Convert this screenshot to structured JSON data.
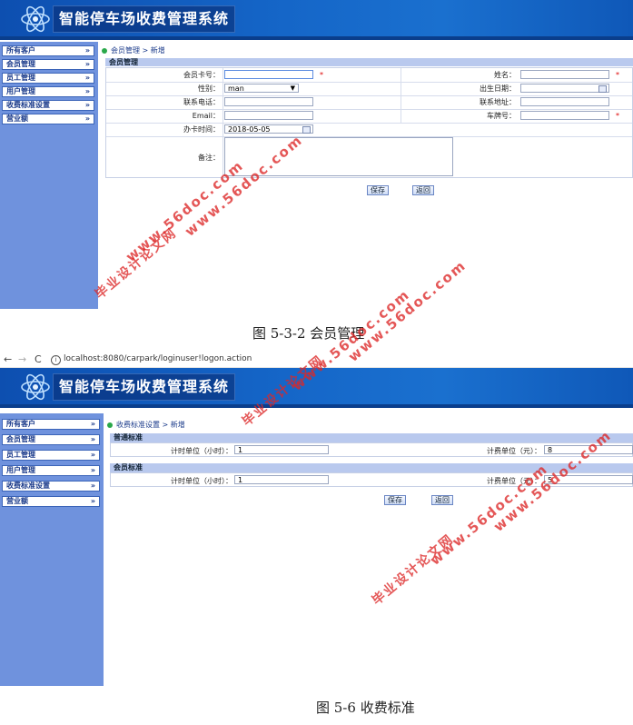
{
  "app_title": "智能停车场收费管理系统",
  "menu": [
    {
      "label": "所有客户"
    },
    {
      "label": "会员管理"
    },
    {
      "label": "员工管理"
    },
    {
      "label": "用户管理"
    },
    {
      "label": "收费标准设置"
    },
    {
      "label": "营业额"
    }
  ],
  "menu_chevron": "»",
  "shot1": {
    "breadcrumb": {
      "section": "会员管理",
      "sep": ">",
      "page": "新增"
    },
    "section_title": "会员管理",
    "fields": {
      "card_no": {
        "label": "会员卡号：",
        "value": ""
      },
      "name": {
        "label": "姓名：",
        "value": ""
      },
      "gender": {
        "label": "性别：",
        "value": "man"
      },
      "birthday": {
        "label": "出生日期：",
        "value": ""
      },
      "phone": {
        "label": "联系电话：",
        "value": ""
      },
      "address": {
        "label": "联系地址：",
        "value": ""
      },
      "email": {
        "label": "Email：",
        "value": ""
      },
      "plate": {
        "label": "车牌号：",
        "value": ""
      },
      "card_date": {
        "label": "办卡时间：",
        "value": "2018-05-05"
      },
      "remark": {
        "label": "备注：",
        "value": ""
      }
    },
    "required_mark": "*",
    "save_label": "保存",
    "back_label": "返回",
    "caption": "图 5-3-2 会员管理"
  },
  "browser": {
    "url": "localhost:8080/carpark/loginuser!logon.action",
    "back": "←",
    "forward": "→",
    "reload": "C",
    "info": "i"
  },
  "shot2": {
    "breadcrumb": {
      "section": "收费标准设置",
      "sep": ">",
      "page": "新增"
    },
    "normal_title": "普通标准",
    "member_title": "会员标准",
    "normal": {
      "time_label": "计时单位（小时）：",
      "time_value": "1",
      "fee_label": "计费单位（元）：",
      "fee_value": "8"
    },
    "member": {
      "time_label": "计时单位（小时）：",
      "time_value": "1",
      "fee_label": "计费单位（元）：",
      "fee_value": "5"
    },
    "save_label": "保存",
    "back_label": "返回",
    "caption": "图 5-6 收费标准"
  },
  "watermark": {
    "site": "www.56doc.com",
    "cn": "毕业设计论文网"
  },
  "colors": {
    "header": "#1566c8",
    "sidebar": "#6f92dd",
    "section": "#b9c9ee",
    "watermark": "#dc2828"
  }
}
